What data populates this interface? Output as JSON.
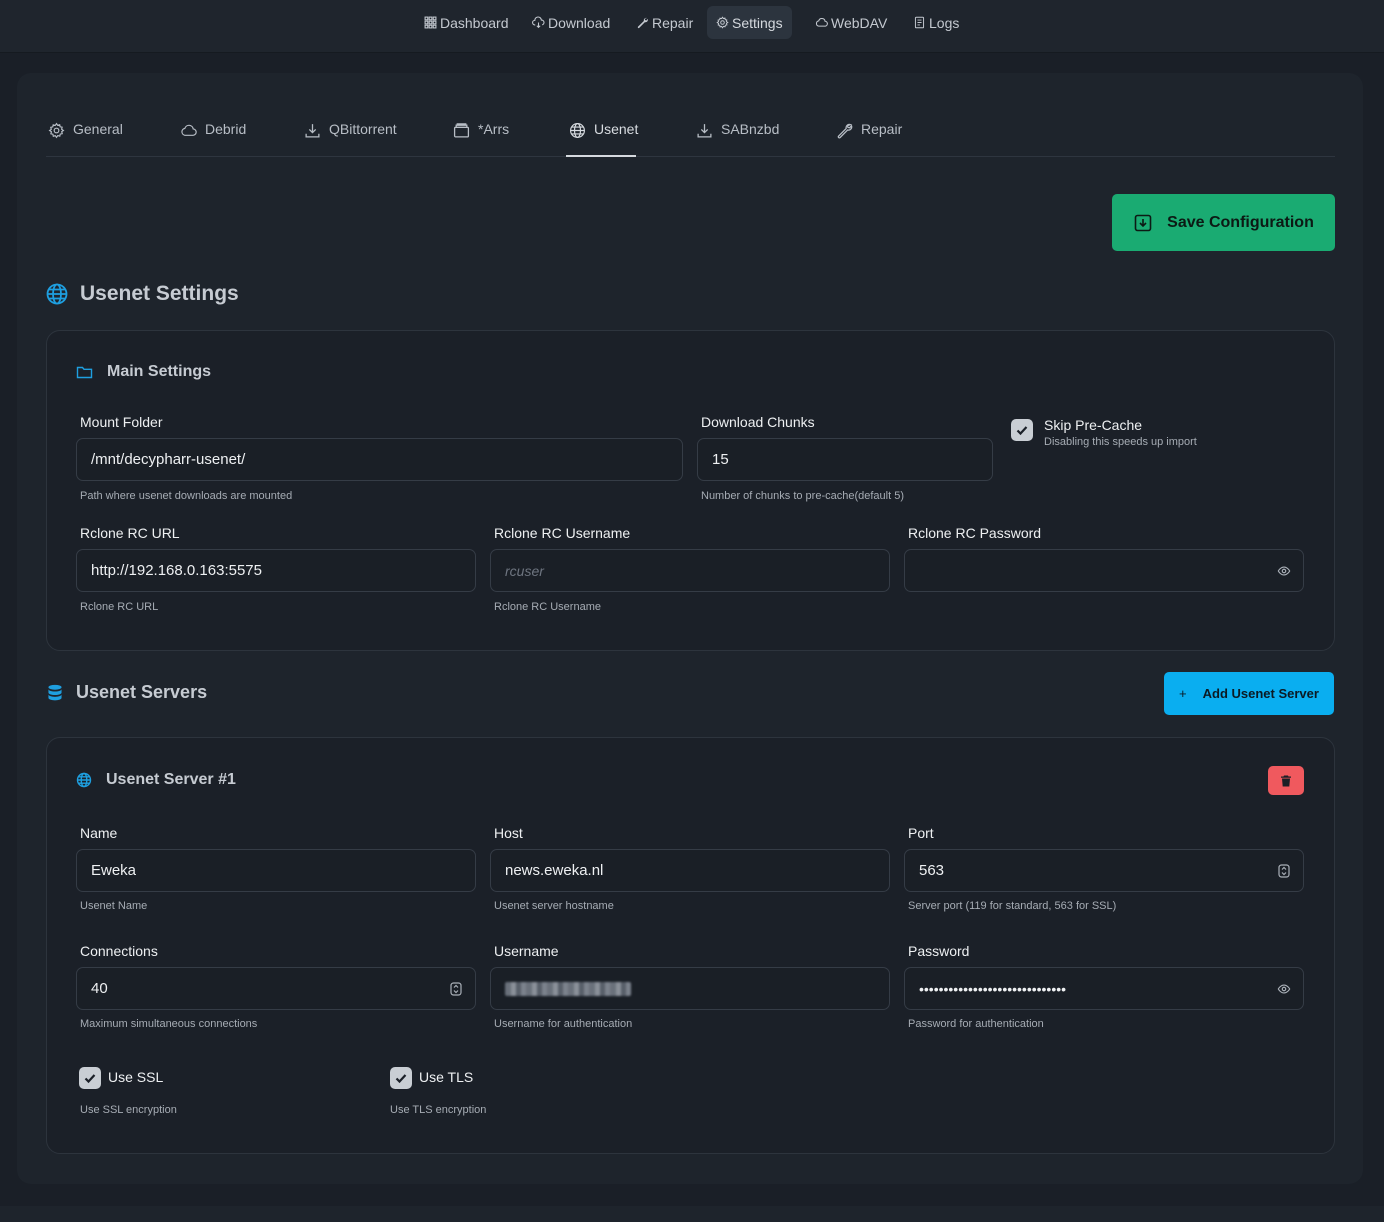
{
  "nav": {
    "items": [
      {
        "label": "Dashboard",
        "icon": "grid-icon"
      },
      {
        "label": "Download",
        "icon": "cloud-download-icon"
      },
      {
        "label": "Repair",
        "icon": "wrench-icon"
      },
      {
        "label": "Settings",
        "icon": "gear-icon",
        "active": true
      },
      {
        "label": "WebDAV",
        "icon": "cloud-icon"
      },
      {
        "label": "Logs",
        "icon": "file-text-icon"
      }
    ]
  },
  "tabs": [
    {
      "label": "General",
      "icon": "gear-icon"
    },
    {
      "label": "Debrid",
      "icon": "cloud-icon"
    },
    {
      "label": "QBittorrent",
      "icon": "download-icon"
    },
    {
      "label": "*Arrs",
      "icon": "archive-icon"
    },
    {
      "label": "Usenet",
      "icon": "globe-icon",
      "active": true
    },
    {
      "label": "SABnzbd",
      "icon": "download-icon"
    },
    {
      "label": "Repair",
      "icon": "wrench-icon"
    }
  ],
  "save_button": "Save Configuration",
  "usenet_settings": {
    "title": "Usenet Settings",
    "main": {
      "title": "Main Settings",
      "mount_folder": {
        "label": "Mount Folder",
        "value": "/mnt/decypharr-usenet/",
        "help": "Path where usenet downloads are mounted"
      },
      "download_chunks": {
        "label": "Download Chunks",
        "value": "15",
        "help": "Number of chunks to pre-cache(default 5)"
      },
      "skip_precache": {
        "label": "Skip Pre-Cache",
        "help": "Disabling this speeds up import",
        "checked": true
      },
      "rclone_url": {
        "label": "Rclone RC URL",
        "value": "http://192.168.0.163:5575",
        "help": "Rclone RC URL"
      },
      "rclone_username": {
        "label": "Rclone RC Username",
        "placeholder": "rcuser",
        "help": "Rclone RC Username"
      },
      "rclone_password": {
        "label": "Rclone RC Password",
        "value": ""
      }
    }
  },
  "servers": {
    "title": "Usenet Servers",
    "add_button": "Add Usenet Server",
    "add_button_icon": "+",
    "list": [
      {
        "title": "Usenet Server #1",
        "name": {
          "label": "Name",
          "value": "Eweka",
          "help": "Usenet Name"
        },
        "host": {
          "label": "Host",
          "value": "news.eweka.nl",
          "help": "Usenet server hostname"
        },
        "port": {
          "label": "Port",
          "value": "563",
          "help": "Server port (119 for standard, 563 for SSL)"
        },
        "connections": {
          "label": "Connections",
          "value": "40",
          "help": "Maximum simultaneous connections"
        },
        "username": {
          "label": "Username",
          "help": "Username for authentication"
        },
        "password": {
          "label": "Password",
          "value": "••••••••••••••••••••••••••••••",
          "help": "Password for authentication"
        },
        "use_ssl": {
          "label": "Use SSL",
          "help": "Use SSL encryption",
          "checked": true
        },
        "use_tls": {
          "label": "Use TLS",
          "help": "Use TLS encryption",
          "checked": true
        }
      }
    ]
  },
  "colors": {
    "save": "#1aab72",
    "add": "#0aaef0",
    "delete": "#f0595e",
    "accent_icon": "#1e9fe0"
  }
}
